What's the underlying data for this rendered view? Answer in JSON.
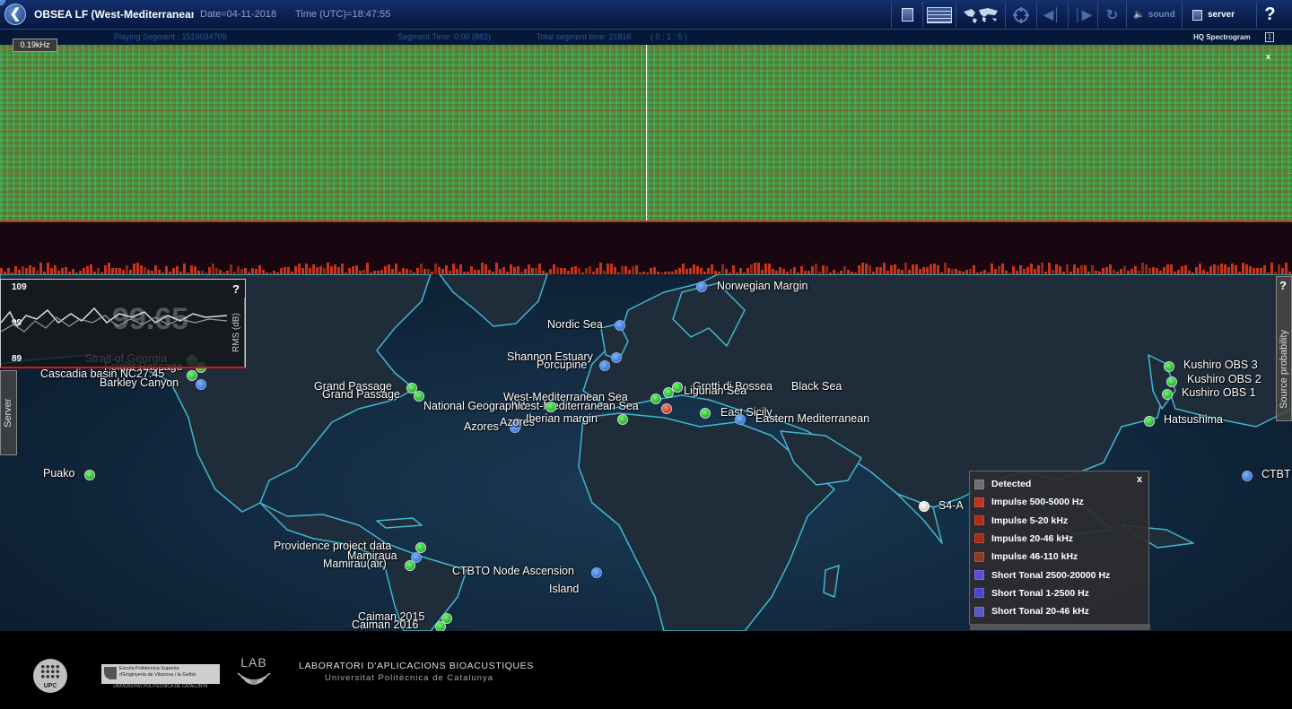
{
  "header": {
    "title": "OBSEA LF (West-Mediterranean Se",
    "date": "Date=04-11-2018",
    "time": "Time (UTC)=18:47:55",
    "sound_label": "sound",
    "server_label": "server",
    "help_label": "?"
  },
  "segment_bar": {
    "playing_segment": "Playing Segment : 1519034709",
    "segment_time": "Segment Time: 0:00  (882)",
    "total_time": "Total segment time: 21816",
    "code": "( 0 : 1 : 5 )",
    "hq_label": "HQ Spectrogram",
    "freq_badge": "0.19kHz"
  },
  "spectrogram": {
    "close_label": "x"
  },
  "rms_panel": {
    "tick_top": "109",
    "tick_mid": "99",
    "tick_bottom": "89",
    "current_value": "99.65",
    "axis_label": "RMS (dB)",
    "help_label": "?"
  },
  "side_tabs": {
    "server": "Server",
    "source_probability": "Source probability",
    "source_help": "?"
  },
  "stations": [
    {
      "name": "Norwegian Margin",
      "color": "blue"
    },
    {
      "name": "Nordic Sea",
      "color": "blue"
    },
    {
      "name": "Shannon Estuary",
      "color": "blue"
    },
    {
      "name": "Porcupine",
      "color": "blue"
    },
    {
      "name": "Grotti di Bossea",
      "color": "green"
    },
    {
      "name": "Black Sea",
      "color": "blue"
    },
    {
      "name": "Ligurian Sea",
      "color": "green"
    },
    {
      "name": "West-Mediterranean Sea",
      "color": "green"
    },
    {
      "name": "West-Mediterranean Sea",
      "color": "red"
    },
    {
      "name": "Iberian margin",
      "color": "green"
    },
    {
      "name": "East Sicily",
      "color": "green"
    },
    {
      "name": "Eastern Mediterranean",
      "color": "blue"
    },
    {
      "name": "National Geographic",
      "color": "green"
    },
    {
      "name": "Azores",
      "color": "blue"
    },
    {
      "name": "Azores",
      "color": "blue"
    },
    {
      "name": "Strait of Georgia",
      "color": "green"
    },
    {
      "name": "Folger Passage",
      "color": "green"
    },
    {
      "name": "Cascadia basin NC27.45",
      "color": "green"
    },
    {
      "name": "Barkley Canyon",
      "color": "blue"
    },
    {
      "name": "Grand Passage",
      "color": "green"
    },
    {
      "name": "Grand Passage",
      "color": "green"
    },
    {
      "name": "Puako",
      "color": "green"
    },
    {
      "name": "Kushiro OBS 3",
      "color": "green"
    },
    {
      "name": "Kushiro OBS 2",
      "color": "green"
    },
    {
      "name": "Kushiro OBS 1",
      "color": "green"
    },
    {
      "name": "Hatsushima",
      "color": "green"
    },
    {
      "name": "CTBT",
      "color": "blue"
    },
    {
      "name": "S4-A",
      "color": "white"
    },
    {
      "name": "Providence project data",
      "color": "green"
    },
    {
      "name": "Mamiraua",
      "color": "blue"
    },
    {
      "name": "Mamirau(air)",
      "color": "green"
    },
    {
      "name": "CTBTO Node Ascension",
      "color": "blue"
    },
    {
      "name": "Island",
      "color": "none"
    },
    {
      "name": "Caiman 2015",
      "color": "green"
    },
    {
      "name": "Caiman 2016",
      "color": "green"
    }
  ],
  "legend": {
    "close_label": "x",
    "items": [
      {
        "label": "Detected",
        "color": "#6e6e6e"
      },
      {
        "label": "Impulse 500-5000 Hz",
        "color": "#c0321c"
      },
      {
        "label": "Impulse 5-20 kHz",
        "color": "#b02c16"
      },
      {
        "label": "Impulse 20-46 kHz",
        "color": "#a52a15"
      },
      {
        "label": "Impulse 46-110 kHz",
        "color": "#8e3a1c"
      },
      {
        "label": "Short Tonal 2500-20000 Hz",
        "color": "#5f4fd0"
      },
      {
        "label": "Short Tonal 1-2500 Hz",
        "color": "#4b45d8"
      },
      {
        "label": "Short Tonal 20-46 kHz",
        "color": "#5a59c4"
      }
    ]
  },
  "footer": {
    "upc": "UPC",
    "school_line1": "Escola Politècnica Superior",
    "school_line2": "d'Enginyeria de Vilanova i la Geltrú",
    "school_line3": "UNIVERSITAT POLITÈCNICA DE CATALUNYA",
    "lab_logo": "LAB",
    "lab_name": "LABORATORI D'APLICACIONS BIOACUSTIQUES",
    "lab_sub": "Universitat Politècnica de Catalunya"
  },
  "colors": {
    "accent": "#0b1f4f",
    "spectro_base": "#4e8f34",
    "event_red": "#c83418",
    "map_ocean": "#12283d"
  }
}
